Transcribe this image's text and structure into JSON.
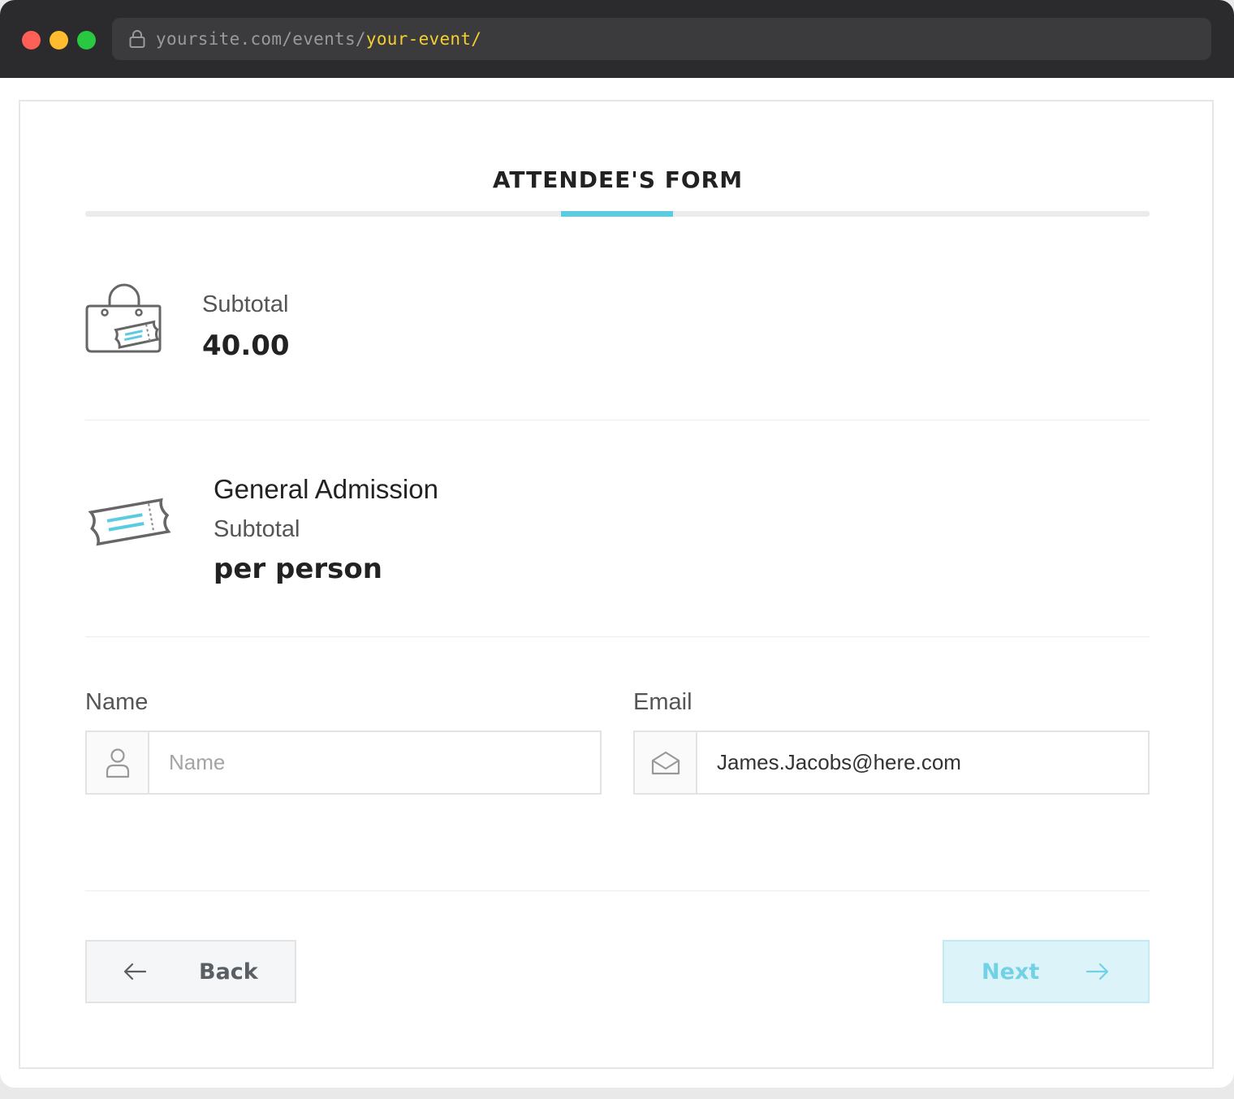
{
  "browser": {
    "url_base": "yoursite.com/events/",
    "url_path": "your-event/",
    "colors": {
      "url_path": "#f4cf2f",
      "accent": "#5bcbe2"
    }
  },
  "form": {
    "title": "ATTENDEE'S FORM",
    "step_progress": 0.5
  },
  "summary": {
    "icon": "shopping-bag-ticket-icon",
    "subtotal_label": "Subtotal",
    "subtotal_value": "40.00"
  },
  "ticket": {
    "icon": "ticket-icon",
    "name": "General Admission",
    "subtotal_label": "Subtotal",
    "price": "per person"
  },
  "fields": {
    "name": {
      "label": "Name",
      "placeholder": "Name",
      "value": "",
      "icon": "user-icon"
    },
    "email": {
      "label": "Email",
      "placeholder": "",
      "value": "James.Jacobs@here.com",
      "icon": "envelope-icon"
    }
  },
  "actions": {
    "back_label": "Back",
    "next_label": "Next"
  }
}
